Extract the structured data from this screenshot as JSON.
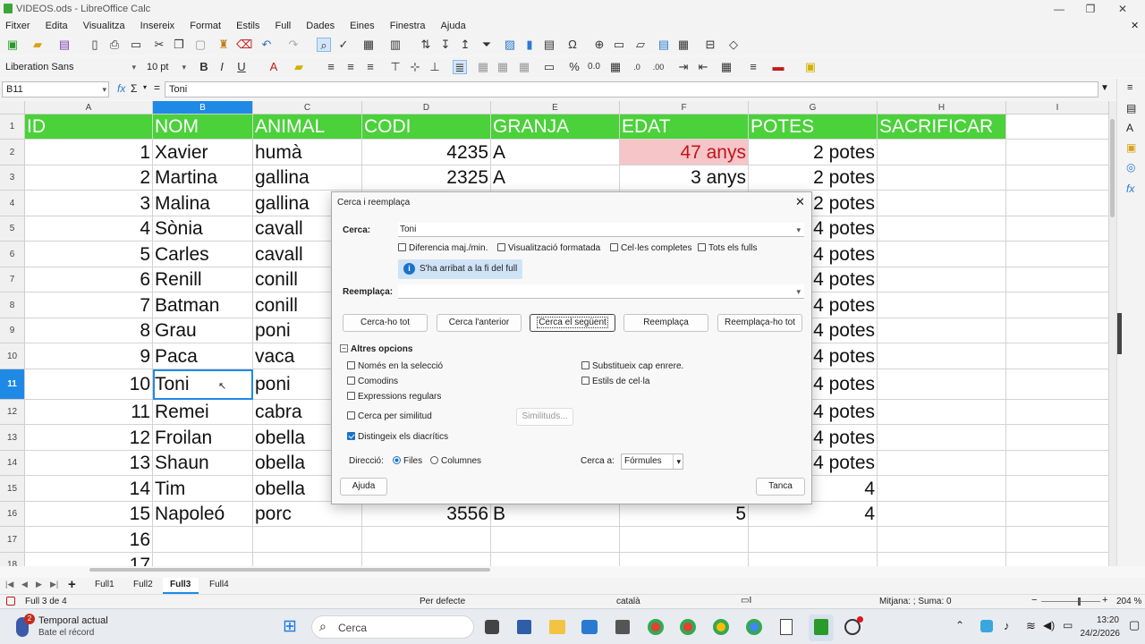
{
  "window": {
    "title": "VIDEOS.ods - LibreOffice Calc"
  },
  "menu": [
    "Fitxer",
    "Edita",
    "Visualitza",
    "Insereix",
    "Format",
    "Estils",
    "Full",
    "Dades",
    "Eines",
    "Finestra",
    "Ajuda"
  ],
  "font": {
    "name": "Liberation Sans",
    "size": "10 pt"
  },
  "formula": {
    "cell_ref": "B11",
    "content": "Toni"
  },
  "columns": [
    "A",
    "B",
    "C",
    "D",
    "E",
    "F",
    "G",
    "H",
    "I"
  ],
  "header_row": [
    "ID",
    "NOM",
    "ANIMAL",
    "CODI",
    "GRANJA",
    "EDAT",
    "POTES",
    "SACRIFICAR"
  ],
  "rows": [
    {
      "n": "1",
      "id": "1",
      "nom": "Xavier",
      "animal": "humà",
      "codi": "4235",
      "granja": "A",
      "edat": "47 anys",
      "potes": "2 potes"
    },
    {
      "n": "2",
      "id": "2",
      "nom": "Martina",
      "animal": "gallina",
      "codi": "2325",
      "granja": "A",
      "edat": "3 anys",
      "potes": "2 potes"
    },
    {
      "n": "3",
      "id": "3",
      "nom": "Malina",
      "animal": "gallina",
      "codi": "",
      "granja": "",
      "edat": "",
      "potes": "2 potes"
    },
    {
      "n": "4",
      "id": "4",
      "nom": "Sònia",
      "animal": "cavall",
      "codi": "",
      "granja": "",
      "edat": "",
      "potes": "4 potes"
    },
    {
      "n": "5",
      "id": "5",
      "nom": "Carles",
      "animal": "cavall",
      "codi": "",
      "granja": "",
      "edat": "",
      "potes": "4 potes"
    },
    {
      "n": "6",
      "id": "6",
      "nom": "Renill",
      "animal": "conill",
      "codi": "",
      "granja": "",
      "edat": "",
      "potes": "4 potes"
    },
    {
      "n": "7",
      "id": "7",
      "nom": "Batman",
      "animal": "conill",
      "codi": "",
      "granja": "",
      "edat": "",
      "potes": "4 potes"
    },
    {
      "n": "8",
      "id": "8",
      "nom": "Grau",
      "animal": "poni",
      "codi": "",
      "granja": "",
      "edat": "",
      "potes": "4 potes"
    },
    {
      "n": "9",
      "id": "9",
      "nom": "Paca",
      "animal": "vaca",
      "codi": "",
      "granja": "",
      "edat": "",
      "potes": "4 potes"
    },
    {
      "n": "10",
      "id": "10",
      "nom": "Toni",
      "animal": "poni",
      "codi": "",
      "granja": "",
      "edat": "",
      "potes": "4 potes"
    },
    {
      "n": "11",
      "id": "11",
      "nom": "Remei",
      "animal": "cabra",
      "codi": "",
      "granja": "",
      "edat": "",
      "potes": "4 potes"
    },
    {
      "n": "12",
      "id": "12",
      "nom": "Froilan",
      "animal": "obella",
      "codi": "",
      "granja": "",
      "edat": "",
      "potes": "4 potes"
    },
    {
      "n": "13",
      "id": "13",
      "nom": "Shaun",
      "animal": "obella",
      "codi": "",
      "granja": "",
      "edat": "",
      "potes": "4 potes"
    },
    {
      "n": "14",
      "id": "14",
      "nom": "Tim",
      "animal": "obella",
      "codi": "",
      "granja": "",
      "edat": "",
      "potes": "4"
    },
    {
      "n": "15",
      "id": "15",
      "nom": "Napoleó",
      "animal": "porc",
      "codi": "3556",
      "granja": "B",
      "edat": "5",
      "potes": "4"
    },
    {
      "n": "16",
      "id": "16",
      "nom": "",
      "animal": "",
      "codi": "",
      "granja": "",
      "edat": "",
      "potes": ""
    },
    {
      "n": "17",
      "id": "17",
      "nom": "",
      "animal": "",
      "codi": "",
      "granja": "",
      "edat": "",
      "potes": ""
    }
  ],
  "dialog": {
    "title": "Cerca i reemplaça",
    "search_label": "Cerca:",
    "search_value": "Toni",
    "opt_case": "Diferencia maj./min.",
    "opt_formatted": "Visualització formatada",
    "opt_entire": "Cel·les completes",
    "opt_allsheets": "Tots els fulls",
    "info": "S'ha arribat a la fi del full",
    "replace_label": "Reemplaça:",
    "replace_value": "",
    "btn_find_all": "Cerca-ho tot",
    "btn_find_prev": "Cerca l'anterior",
    "btn_find_next": "Cerca el següent",
    "btn_replace": "Reemplaça",
    "btn_replace_all": "Reemplaça-ho tot",
    "other_options": "Altres opcions",
    "opt_selection": "Només en la selecció",
    "opt_wildcards": "Comodins",
    "opt_regex": "Expressions regulars",
    "opt_similarity": "Cerca per similitud",
    "btn_similarities": "Similituds...",
    "opt_diacritics": "Distingeix els diacrítics",
    "opt_backwards": "Substitueix cap enrere.",
    "opt_cellstyles": "Estils de cel·la",
    "direction_label": "Direcció:",
    "dir_rows": "Files",
    "dir_cols": "Columnes",
    "search_in_label": "Cerca a:",
    "search_in_value": "Fórmules",
    "btn_help": "Ajuda",
    "btn_close": "Tanca"
  },
  "sheets": [
    "Full1",
    "Full2",
    "Full3",
    "Full4"
  ],
  "active_sheet": "Full3",
  "status": {
    "sheet": "Full 3 de 4",
    "style": "Per defecte",
    "lang": "català",
    "sum": "Mitjana: ; Suma: 0",
    "zoom": "204 %"
  },
  "taskbar": {
    "weather_title": "Temporal actual",
    "weather_sub": "Bate el récord",
    "weather_badge": "2",
    "search": "Cerca",
    "time": "13:20",
    "date": "24/2/2026"
  }
}
